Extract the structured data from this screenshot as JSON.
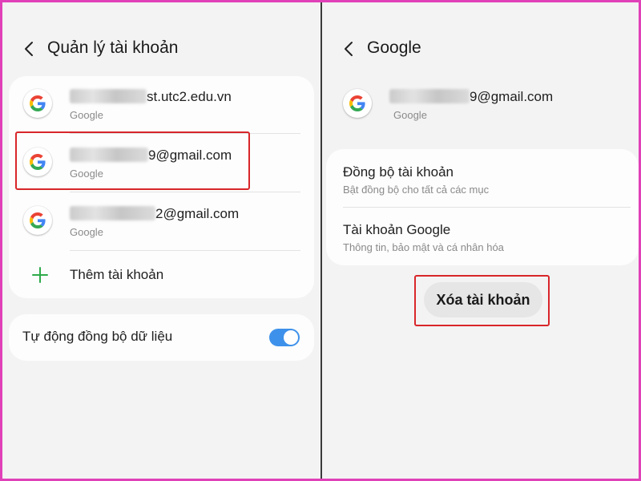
{
  "left": {
    "title": "Quản lý tài khoản",
    "accounts": [
      {
        "email_suffix": "st.utc2.edu.vn",
        "provider": "Google"
      },
      {
        "email_suffix": "9@gmail.com",
        "provider": "Google"
      },
      {
        "email_suffix": "2@gmail.com",
        "provider": "Google"
      }
    ],
    "add_account_label": "Thêm tài khoản",
    "auto_sync_label": "Tự động đồng bộ dữ liệu",
    "auto_sync_on": true
  },
  "right": {
    "title": "Google",
    "account": {
      "email_suffix": "9@gmail.com",
      "provider": "Google"
    },
    "menu": [
      {
        "title": "Đồng bộ tài khoản",
        "subtitle": "Bật đồng bộ cho tất cả các mục"
      },
      {
        "title": "Tài khoản Google",
        "subtitle": "Thông tin, bảo mật và cá nhân hóa"
      }
    ],
    "remove_button_label": "Xóa tài khoản"
  },
  "colors": {
    "frame_border": "#e040b8",
    "highlight": "#d8262a",
    "toggle_on": "#3e91ea",
    "plus_green": "#2eaa4a"
  }
}
